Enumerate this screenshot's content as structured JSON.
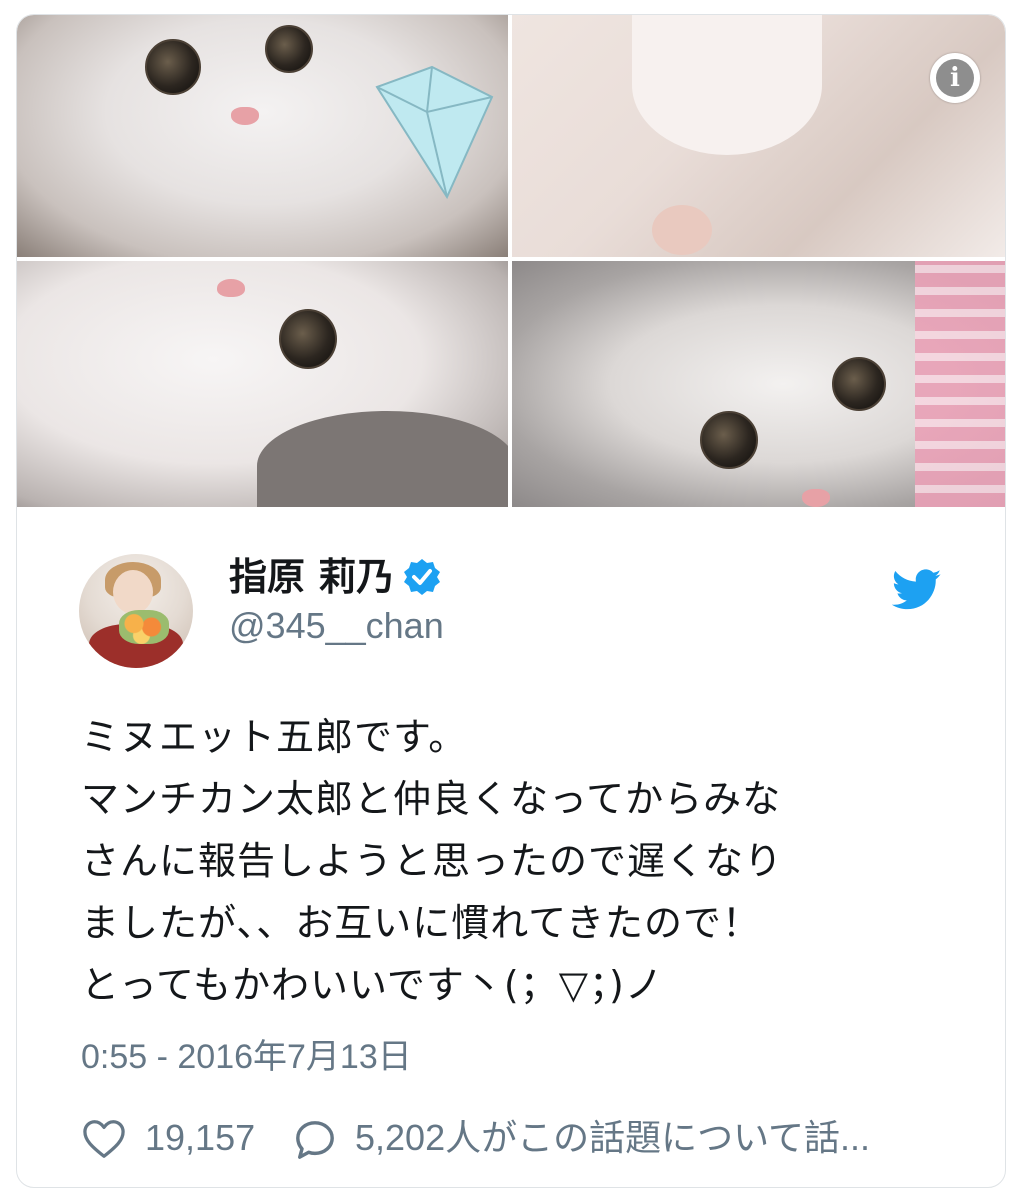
{
  "media": {
    "photo_count": 4,
    "info_icon": "info-icon"
  },
  "author": {
    "display_name": "指原 莉乃",
    "handle": "@345__chan",
    "verified_icon": "verified-badge-icon",
    "avatar_icon": "avatar-photo"
  },
  "brand": {
    "icon": "twitter-bird-icon",
    "color": "#1da1f2"
  },
  "tweet": {
    "lines": [
      "ミヌエット五郎です。",
      "マンチカン太郎と仲良くなってからみな",
      "さんに報告しようと思ったので遅くなり",
      "ましたが、、お互いに慣れてきたので！",
      "とってもかわいいです丶(；▽；)ノ"
    ],
    "timestamp": "0:55 - 2016年7月13日"
  },
  "actions": {
    "likes": "19,157",
    "like_icon": "heart-icon",
    "replies": "5,202人がこの話題について話...",
    "reply_icon": "speech-bubble-icon"
  },
  "colors": {
    "text": "#14171a",
    "secondary": "#657786",
    "verified": "#1da1f2"
  }
}
